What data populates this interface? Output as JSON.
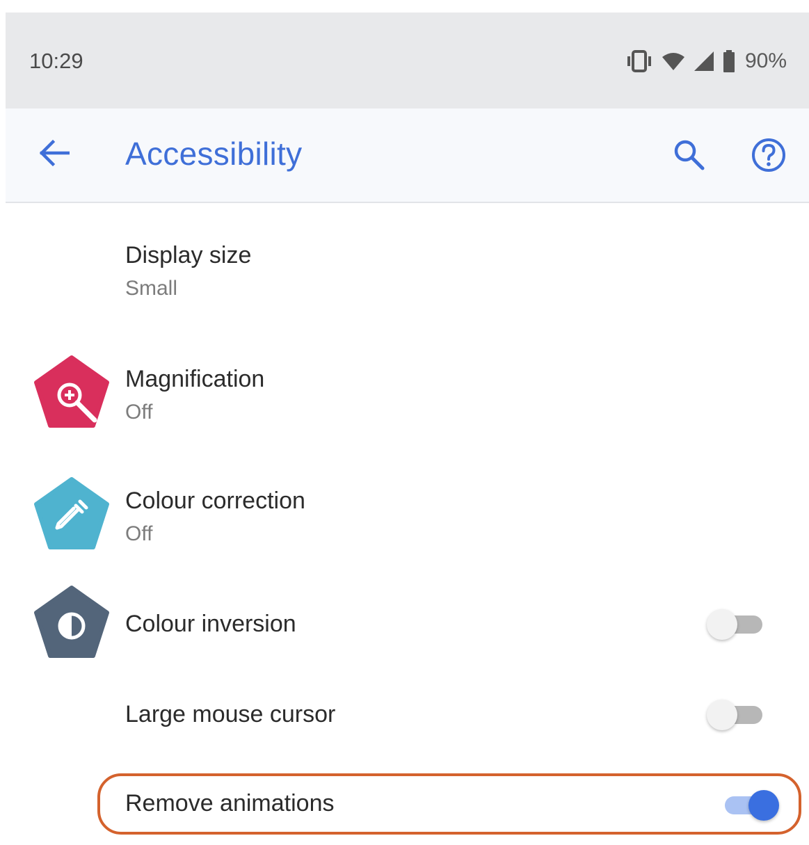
{
  "status_bar": {
    "time": "10:29",
    "icons": [
      "vibrate-icon",
      "wifi-icon",
      "signal-icon",
      "battery-icon"
    ],
    "battery_percent": "90%"
  },
  "app_bar": {
    "title": "Accessibility",
    "back_icon": "arrow-back-icon",
    "search_icon": "search-icon",
    "help_icon": "help-icon",
    "accent_color": "#3f6fd8"
  },
  "settings": [
    {
      "id": "display-size",
      "title": "Display size",
      "summary": "Small"
    },
    {
      "id": "magnification",
      "title": "Magnification",
      "summary": "Off",
      "icon": "magnify-plus-icon",
      "icon_color": "#d92f5c"
    },
    {
      "id": "colour-correction",
      "title": "Colour correction",
      "summary": "Off",
      "icon": "eyedropper-icon",
      "icon_color": "#4fb3cf"
    },
    {
      "id": "colour-inversion",
      "title": "Colour inversion",
      "toggle": false,
      "icon": "contrast-icon",
      "icon_color": "#53657a"
    },
    {
      "id": "large-mouse-cursor",
      "title": "Large mouse cursor",
      "toggle": false
    },
    {
      "id": "remove-animations",
      "title": "Remove animations",
      "toggle": true,
      "highlighted": true,
      "highlight_color": "#d4622d"
    }
  ]
}
